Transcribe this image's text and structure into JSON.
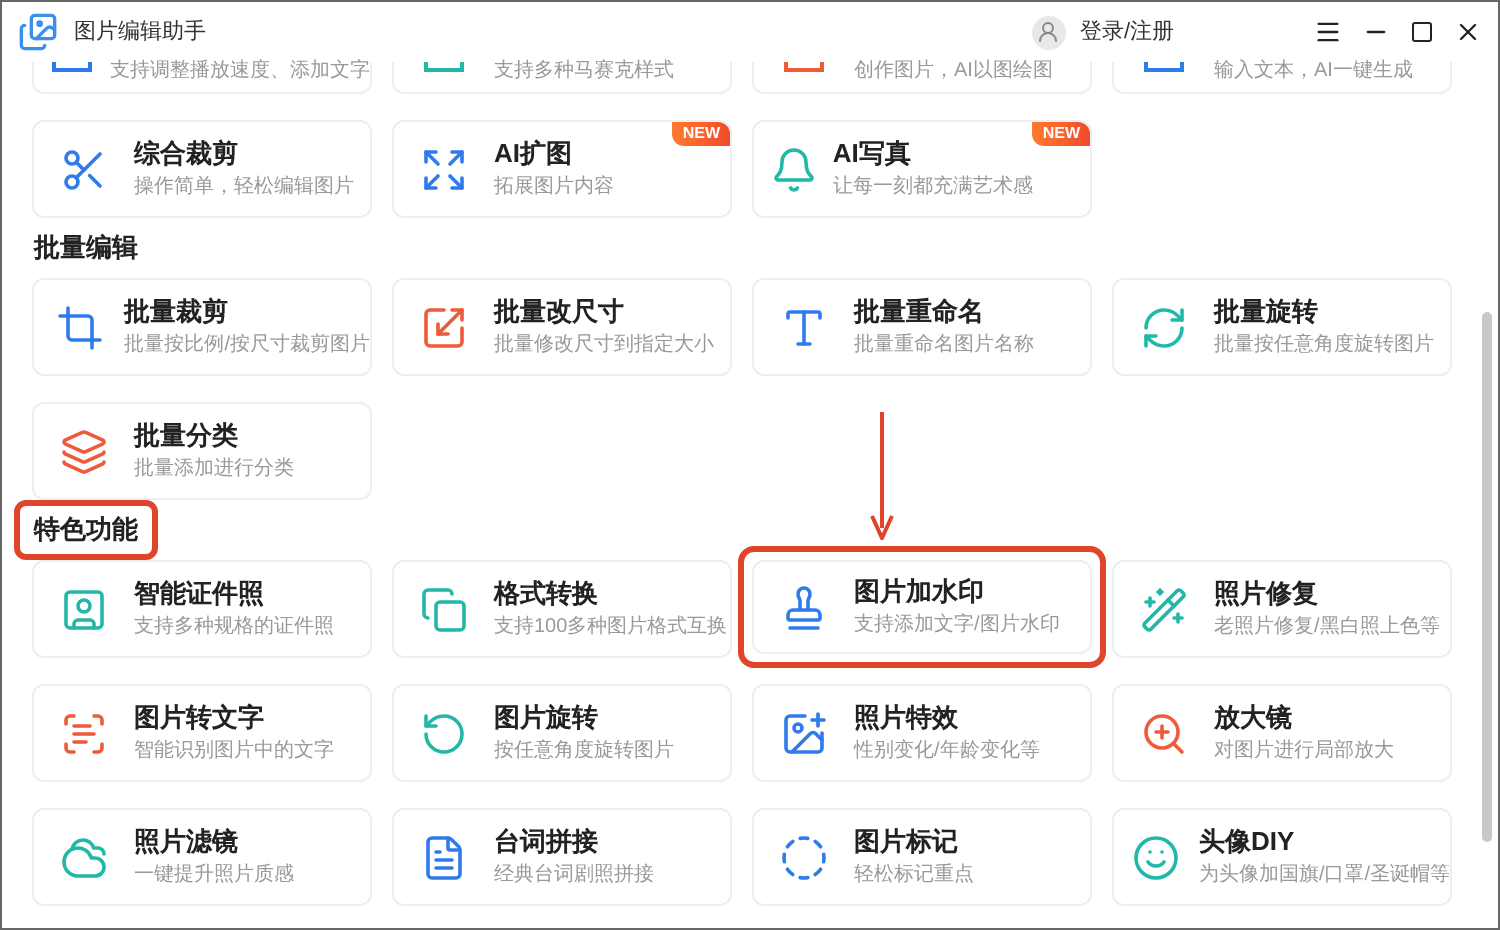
{
  "window": {
    "title": "图片编辑助手"
  },
  "account": {
    "label": "登录/注册"
  },
  "partial_cards": [
    {
      "description": "支持调整播放速度、添加文字"
    },
    {
      "description": "支持多种马赛克样式"
    },
    {
      "description": "创作图片，AI以图绘图"
    },
    {
      "description": "输入文本，AI一键生成"
    }
  ],
  "sections": [
    {
      "cards": [
        {
          "title": "综合裁剪",
          "description": "操作简单，轻松编辑图片",
          "highlighted": false
        },
        {
          "title": "AI扩图",
          "description": "拓展图片内容",
          "badge": "NEW",
          "highlighted": false
        },
        {
          "title": "AI写真",
          "description": "让每一刻都充满艺术感",
          "badge": "NEW",
          "highlighted": false
        }
      ]
    },
    {
      "heading": "批量编辑",
      "highlighted": false,
      "cards": [
        {
          "title": "批量裁剪",
          "description": "批量按比例/按尺寸裁剪图片",
          "highlighted": false
        },
        {
          "title": "批量改尺寸",
          "description": "批量修改尺寸到指定大小",
          "highlighted": false
        },
        {
          "title": "批量重命名",
          "description": "批量重命名图片名称",
          "highlighted": false
        },
        {
          "title": "批量旋转",
          "description": "批量按任意角度旋转图片",
          "highlighted": false
        },
        {
          "title": "批量分类",
          "description": "批量添加进行分类",
          "highlighted": false
        }
      ]
    },
    {
      "heading": "特色功能",
      "highlighted": true,
      "cards": [
        {
          "title": "智能证件照",
          "description": "支持多种规格的证件照",
          "highlighted": false
        },
        {
          "title": "格式转换",
          "description": "支持100多种图片格式互换",
          "highlighted": false
        },
        {
          "title": "图片加水印",
          "description": "支持添加文字/图片水印",
          "highlighted": true
        },
        {
          "title": "照片修复",
          "description": "老照片修复/黑白照上色等",
          "highlighted": false
        },
        {
          "title": "图片转文字",
          "description": "智能识别图片中的文字",
          "highlighted": false
        },
        {
          "title": "图片旋转",
          "description": "按任意角度旋转图片",
          "highlighted": false
        },
        {
          "title": "照片特效",
          "description": "性别变化/年龄变化等",
          "highlighted": false
        },
        {
          "title": "放大镜",
          "description": "对图片进行局部放大",
          "highlighted": false
        },
        {
          "title": "照片滤镜",
          "description": "一键提升照片质感",
          "highlighted": false
        },
        {
          "title": "台词拼接",
          "description": "经典台词剧照拼接",
          "highlighted": false
        },
        {
          "title": "图片标记",
          "description": "轻松标记重点",
          "highlighted": false
        },
        {
          "title": "头像DIY",
          "description": "为头像加国旗/口罩/圣诞帽等",
          "highlighted": false
        }
      ]
    }
  ]
}
